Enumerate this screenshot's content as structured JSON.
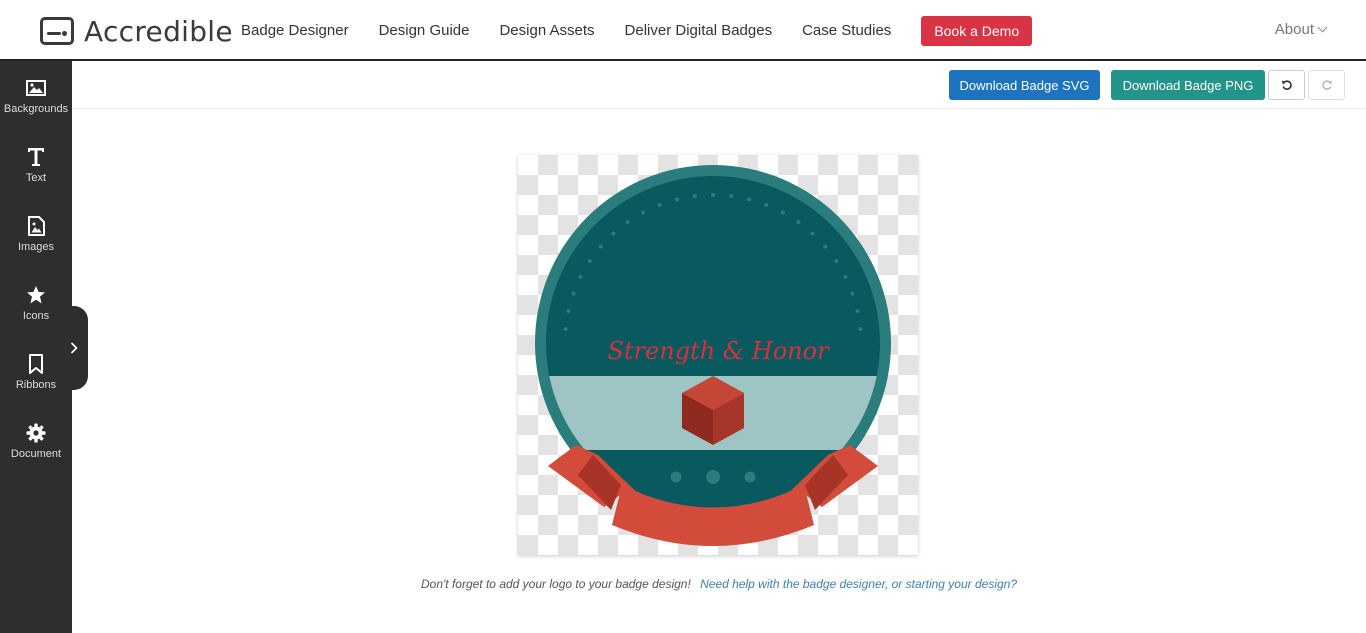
{
  "brand": {
    "name": "Accredible"
  },
  "nav": {
    "links": [
      "Badge Designer",
      "Design Guide",
      "Design Assets",
      "Deliver Digital Badges",
      "Case Studies"
    ],
    "demo_label": "Book a Demo",
    "about_label": "About"
  },
  "sidebar": {
    "items": [
      {
        "label": "Backgrounds",
        "icon": "image-icon"
      },
      {
        "label": "Text",
        "icon": "text-icon"
      },
      {
        "label": "Images",
        "icon": "image-file-icon"
      },
      {
        "label": "Icons",
        "icon": "star-icon"
      },
      {
        "label": "Ribbons",
        "icon": "bookmark-icon"
      },
      {
        "label": "Document",
        "icon": "gear-icon"
      }
    ]
  },
  "toolbar": {
    "download_svg": "Download Badge SVG",
    "download_png": "Download Badge PNG"
  },
  "badge": {
    "text": "Strength & Honor",
    "colors": {
      "outer_ring": "#2b7c7c",
      "inner": "#085a5f",
      "band": "#9ec4c3",
      "ribbon": "#d34b3a",
      "ribbon_dark": "#a83428",
      "text": "#d6303e",
      "cube_top": "#c44635",
      "cube_left": "#8e2a20",
      "cube_right": "#a73528"
    }
  },
  "hint": {
    "text": "Don't forget to add your logo to your badge design!",
    "link": "Need help with the badge designer, or starting your design?"
  }
}
